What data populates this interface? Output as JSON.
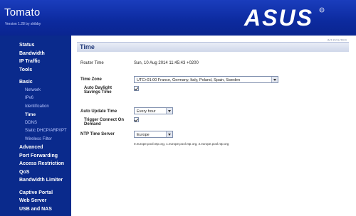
{
  "app": {
    "title": "Tomato",
    "subtitle": "Version 1.28 by shibby",
    "logo_text": "ASUS"
  },
  "sidebar": {
    "groups": [
      {
        "items": [
          {
            "label": "Status",
            "type": "top"
          },
          {
            "label": "Bandwidth",
            "type": "top"
          },
          {
            "label": "IP Traffic",
            "type": "top"
          },
          {
            "label": "Tools",
            "type": "top"
          }
        ]
      },
      {
        "items": [
          {
            "label": "Basic",
            "type": "top"
          },
          {
            "label": "Network",
            "type": "sub"
          },
          {
            "label": "IPv6",
            "type": "sub"
          },
          {
            "label": "Identification",
            "type": "sub"
          },
          {
            "label": "Time",
            "type": "sub",
            "active": true
          },
          {
            "label": "DDNS",
            "type": "sub"
          },
          {
            "label": "Static DHCP/ARP/IPT",
            "type": "sub"
          },
          {
            "label": "Wireless Filter",
            "type": "sub"
          },
          {
            "label": "Advanced",
            "type": "top"
          },
          {
            "label": "Port Forwarding",
            "type": "top"
          },
          {
            "label": "Access Restriction",
            "type": "top"
          },
          {
            "label": "QoS",
            "type": "top"
          },
          {
            "label": "Bandwidth Limiter",
            "type": "top"
          }
        ]
      },
      {
        "items": [
          {
            "label": "Captive Portal",
            "type": "top"
          },
          {
            "label": "Web Server",
            "type": "top"
          },
          {
            "label": "USB and NAS",
            "type": "top"
          }
        ]
      }
    ]
  },
  "page": {
    "router_tag": "INT-ROUTER",
    "section_title": "Time",
    "router_time_label": "Router Time",
    "router_time_value": "Sun, 10 Aug 2014 11:45:43 +0200",
    "time_zone_label": "Time Zone",
    "time_zone_value": "UTC+01:00 France, Germany, Italy, Poland, Spain, Sweden",
    "auto_dst_label_1": "Auto Daylight",
    "auto_dst_label_2": "Savings Time",
    "auto_update_label": "Auto Update Time",
    "auto_update_value": "Every hour",
    "trigger_label_1": "Trigger Connect On",
    "trigger_label_2": "Demand",
    "ntp_label": "NTP Time Server",
    "ntp_value": "Europe",
    "ntp_servers": "0.europe.pool.ntp.org, 1.europe.pool.ntp.org, 2.europe.pool.ntp.org"
  },
  "colors": {
    "header_blue": "#0c2a9e",
    "sidebar_blue": "#0a2a8c",
    "title_text": "#243b7a"
  }
}
